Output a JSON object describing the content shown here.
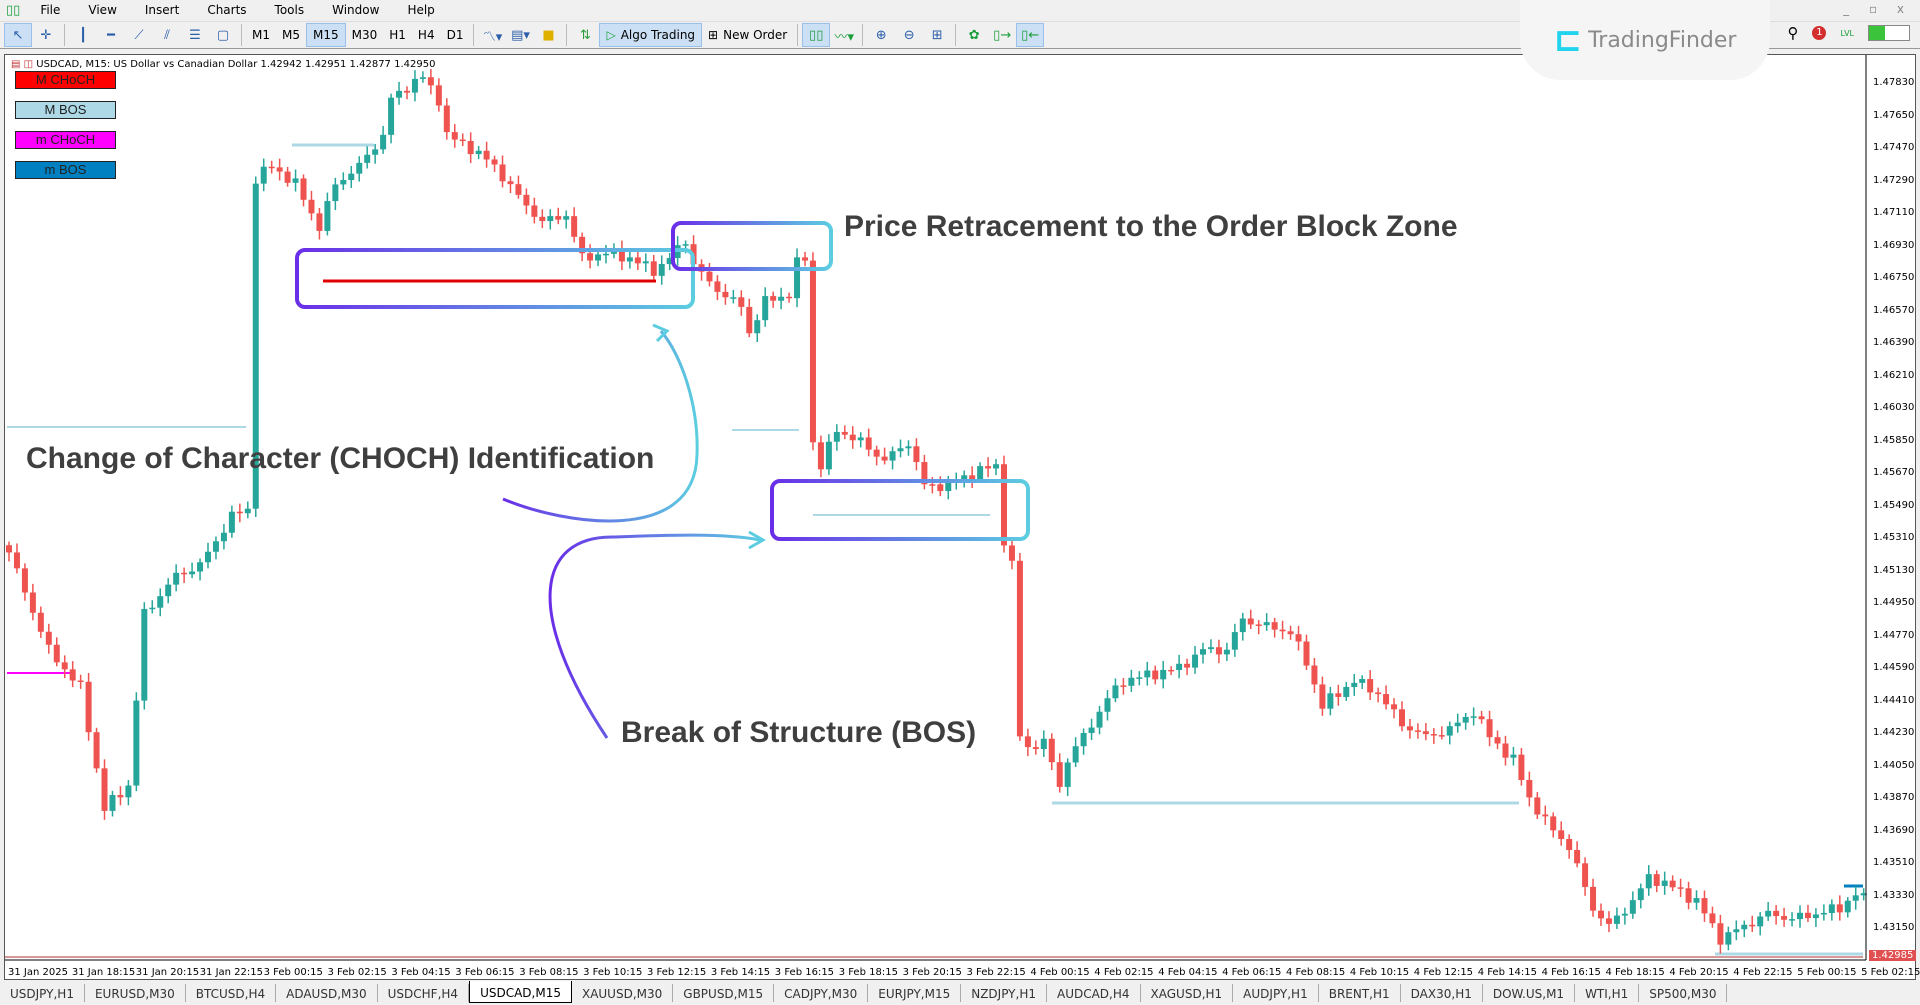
{
  "menu": {
    "items": [
      "File",
      "View",
      "Insert",
      "Charts",
      "Tools",
      "Window",
      "Help"
    ]
  },
  "toolbar": {
    "timeframes": [
      "M1",
      "M5",
      "M15",
      "M30",
      "H1",
      "H4",
      "D1"
    ],
    "active_timeframe": "M15",
    "algo_trading": "Algo Trading",
    "new_order": "New Order"
  },
  "logo": {
    "text": "TradingFinder"
  },
  "notifications": {
    "count": "1"
  },
  "level": {
    "label": "LVL",
    "fill": 0.4
  },
  "chart": {
    "header": "USDCAD, M15:  US Dollar vs Canadian Dollar  1.42942 1.42951 1.42877 1.42950",
    "legend": [
      {
        "label": "M CHoCH",
        "color": "#ff0000"
      },
      {
        "label": "M BOS",
        "color": "#add8e6"
      },
      {
        "label": "m CHoCH",
        "color": "#ff00ff"
      },
      {
        "label": "m BOS",
        "color": "#0080c0"
      }
    ],
    "annotations": {
      "retracement": "Price Retracement to the Order Block Zone",
      "choch": "Change of Character (CHOCH) Identification",
      "bos": "Break of Structure (BOS)"
    },
    "current_price": "1.42985",
    "colors": {
      "bull": "#26a69a",
      "bear": "#ef5350",
      "choch_major": "#ff0000",
      "bos_major": "#add8e6",
      "choch_minor": "#ff00ff",
      "bos_minor": "#0080c0"
    }
  },
  "chart_data": {
    "type": "candlestick",
    "symbol": "USDCAD",
    "timeframe": "M15",
    "y_ticks": [
      "1.47830",
      "1.47650",
      "1.47470",
      "1.47290",
      "1.47110",
      "1.46930",
      "1.46750",
      "1.46570",
      "1.46390",
      "1.46210",
      "1.46030",
      "1.45850",
      "1.45670",
      "1.45490",
      "1.45310",
      "1.45130",
      "1.44950",
      "1.44770",
      "1.44590",
      "1.44410",
      "1.44230",
      "1.44050",
      "1.43870",
      "1.43690",
      "1.43510",
      "1.43330",
      "1.43150"
    ],
    "ylim": [
      1.4282,
      1.48
    ],
    "x_ticks": [
      "31 Jan 2025",
      "31 Jan 18:15",
      "31 Jan 20:15",
      "31 Jan 22:15",
      "3 Feb 00:15",
      "3 Feb 02:15",
      "3 Feb 04:15",
      "3 Feb 06:15",
      "3 Feb 08:15",
      "3 Feb 10:15",
      "3 Feb 12:15",
      "3 Feb 14:15",
      "3 Feb 16:15",
      "3 Feb 18:15",
      "3 Feb 20:15",
      "3 Feb 22:15",
      "4 Feb 00:15",
      "4 Feb 02:15",
      "4 Feb 04:15",
      "4 Feb 06:15",
      "4 Feb 08:15",
      "4 Feb 10:15",
      "4 Feb 12:15",
      "4 Feb 14:15",
      "4 Feb 16:15",
      "4 Feb 18:15",
      "4 Feb 20:15",
      "4 Feb 22:15",
      "5 Feb 00:15",
      "5 Feb 02:15"
    ],
    "close_path_bar_price": [
      [
        0,
        1.4523
      ],
      [
        5,
        1.4469
      ],
      [
        9,
        1.4448
      ],
      [
        12,
        1.4381
      ],
      [
        15,
        1.4394
      ],
      [
        17,
        1.4489
      ],
      [
        21,
        1.451
      ],
      [
        24,
        1.4516
      ],
      [
        28,
        1.4543
      ],
      [
        30,
        1.4547
      ],
      [
        31,
        1.473
      ],
      [
        33,
        1.4737
      ],
      [
        36,
        1.4727
      ],
      [
        39,
        1.4703
      ],
      [
        41,
        1.4727
      ],
      [
        44,
        1.4737
      ],
      [
        47,
        1.4754
      ],
      [
        48,
        1.4774
      ],
      [
        51,
        1.4784
      ],
      [
        52,
        1.4786
      ],
      [
        54,
        1.4774
      ],
      [
        55,
        1.4754
      ],
      [
        58,
        1.4747
      ],
      [
        61,
        1.4737
      ],
      [
        64,
        1.472
      ],
      [
        67,
        1.4706
      ],
      [
        70,
        1.471
      ],
      [
        72,
        1.4686
      ],
      [
        75,
        1.4689
      ],
      [
        78,
        1.4686
      ],
      [
        81,
        1.4679
      ],
      [
        83,
        1.4686
      ],
      [
        85,
        1.4696
      ],
      [
        86,
        1.4683
      ],
      [
        88,
        1.4672
      ],
      [
        92,
        1.4659
      ],
      [
        93,
        1.4645
      ],
      [
        95,
        1.4662
      ],
      [
        98,
        1.4666
      ],
      [
        99,
        1.4683
      ],
      [
        100,
        1.4686
      ],
      [
        101,
        1.4584
      ],
      [
        102,
        1.4571
      ],
      [
        104,
        1.4591
      ],
      [
        107,
        1.4584
      ],
      [
        110,
        1.4574
      ],
      [
        113,
        1.4584
      ],
      [
        115,
        1.456
      ],
      [
        118,
        1.456
      ],
      [
        121,
        1.4567
      ],
      [
        124,
        1.4571
      ],
      [
        125,
        1.453
      ],
      [
        126,
        1.4516
      ],
      [
        127,
        1.4421
      ],
      [
        128,
        1.4415
      ],
      [
        130,
        1.4418
      ],
      [
        132,
        1.4394
      ],
      [
        133,
        1.4408
      ],
      [
        136,
        1.4428
      ],
      [
        138,
        1.4442
      ],
      [
        140,
        1.4452
      ],
      [
        143,
        1.4455
      ],
      [
        147,
        1.4459
      ],
      [
        150,
        1.4469
      ],
      [
        153,
        1.4469
      ],
      [
        155,
        1.4486
      ],
      [
        158,
        1.4482
      ],
      [
        161,
        1.4479
      ],
      [
        163,
        1.4462
      ],
      [
        165,
        1.4438
      ],
      [
        169,
        1.4452
      ],
      [
        172,
        1.4445
      ],
      [
        175,
        1.4428
      ],
      [
        178,
        1.4421
      ],
      [
        181,
        1.4425
      ],
      [
        184,
        1.4435
      ],
      [
        186,
        1.4421
      ],
      [
        189,
        1.4408
      ],
      [
        191,
        1.4387
      ],
      [
        193,
        1.4374
      ],
      [
        196,
        1.436
      ],
      [
        199,
        1.4326
      ],
      [
        201,
        1.4316
      ],
      [
        204,
        1.433
      ],
      [
        206,
        1.4343
      ],
      [
        208,
        1.434
      ],
      [
        212,
        1.433
      ],
      [
        215,
        1.4309
      ],
      [
        218,
        1.4316
      ],
      [
        221,
        1.4323
      ],
      [
        224,
        1.432
      ],
      [
        227,
        1.4323
      ],
      [
        230,
        1.4326
      ],
      [
        232,
        1.4334
      ],
      [
        233,
        1.4331
      ]
    ]
  },
  "tabs": [
    {
      "label": "USDJPY,H1"
    },
    {
      "label": "EURUSD,M30"
    },
    {
      "label": "BTCUSD,H4"
    },
    {
      "label": "ADAUSD,M30"
    },
    {
      "label": "USDCHF,H4"
    },
    {
      "label": "USDCAD,M15",
      "active": true
    },
    {
      "label": "XAUUSD,M30"
    },
    {
      "label": "GBPUSD,M15"
    },
    {
      "label": "CADJPY,M30"
    },
    {
      "label": "EURJPY,M15"
    },
    {
      "label": "NZDJPY,H1"
    },
    {
      "label": "AUDCAD,H4"
    },
    {
      "label": "XAGUSD,H1"
    },
    {
      "label": "AUDJPY,H1"
    },
    {
      "label": "BRENT,H1"
    },
    {
      "label": "DAX30,H1"
    },
    {
      "label": "DOW.US,M1"
    },
    {
      "label": "WTI,H1"
    },
    {
      "label": "SP500,M30"
    }
  ]
}
